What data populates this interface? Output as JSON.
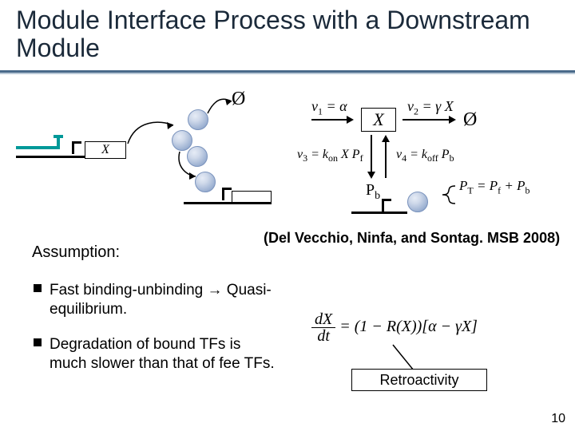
{
  "title": "Module Interface Process with a Downstream Module",
  "diagram": {
    "emptyset": "Ø",
    "gene_x_label": "X",
    "X_node": "X",
    "Pb_label": "P",
    "Pb_sub": "b",
    "v1": {
      "lhs": "v",
      "sub": "1",
      "rhs": " = α"
    },
    "v2": {
      "lhs": "v",
      "sub": "2",
      "rhs": " = γ X"
    },
    "v3": {
      "lhs": "v",
      "sub": "3",
      "rhs_a": " = k",
      "rhs_a_sub": "on",
      "rhs_b": " X P",
      "rhs_b_sub": "f"
    },
    "v4": {
      "lhs": "v",
      "sub": "4",
      "rhs_a": " = k",
      "rhs_a_sub": "off",
      "rhs_b": " P",
      "rhs_b_sub": "b"
    },
    "PT_eqn": {
      "lhs": "P",
      "lhs_sub": "T",
      "mid": " = P",
      "mid_sub": "f",
      "end": " + P",
      "end_sub": "b"
    }
  },
  "citation": "(Del Vecchio, Ninfa, and Sontag. MSB 2008)",
  "assumption_label": "Assumption:",
  "bullets": [
    "Fast binding-unbinding → Quasi-equilibrium.",
    "Degradation of bound TFs is much slower than that of fee TFs."
  ],
  "retro_eqn": {
    "frac_num": "dX",
    "frac_den": "dt",
    "rhs": " = (1 − R(X))[α − γX]"
  },
  "retro_label": "Retroactivity",
  "page_number": "10"
}
